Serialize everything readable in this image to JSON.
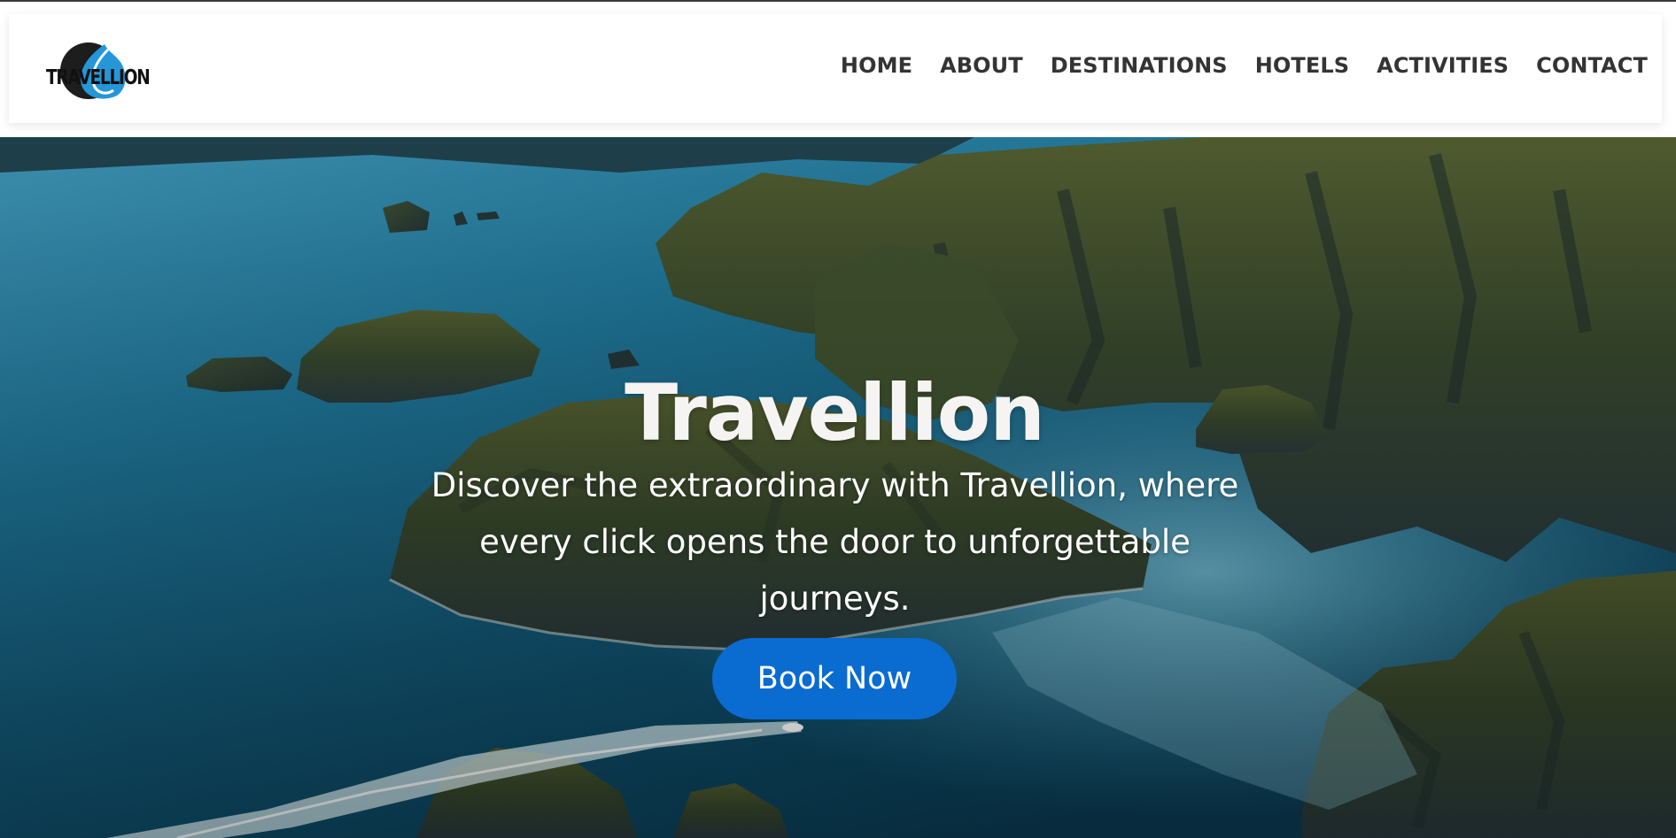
{
  "brand": {
    "logo_text": "TRAVELLION"
  },
  "nav": {
    "items": [
      {
        "label": "HOME"
      },
      {
        "label": "ABOUT"
      },
      {
        "label": "DESTINATIONS"
      },
      {
        "label": "HOTELS"
      },
      {
        "label": "ACTIVITIES"
      },
      {
        "label": "CONTACT"
      }
    ]
  },
  "hero": {
    "title": "Travellion",
    "subtitle": "Discover the extraordinary with Travellion, where every click opens the door to unforgettable journeys.",
    "cta_label": "Book Now",
    "background": "aerial-islands-lagoon-photo"
  },
  "colors": {
    "accent": "#0a6bd0",
    "nav_text": "#343434",
    "hero_text": "#ffffff"
  }
}
